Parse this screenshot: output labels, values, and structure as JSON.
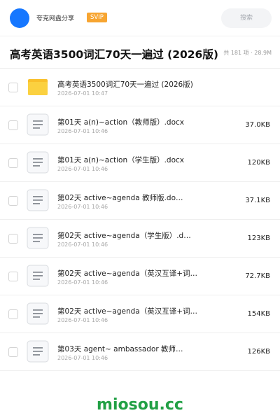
{
  "header": {
    "brand": "夸克网盘分享",
    "badge": "SVIP",
    "search_placeholder": "搜索"
  },
  "title": "高考英语3500词汇70天一遍过 (2026版)",
  "summary": "共 181 项 · 28.9M",
  "files": [
    {
      "icon": "folder-icon",
      "name": "高考英语3500词汇70天一遍过 (2026版)",
      "date": "2026-07-01 10:47",
      "size": ""
    },
    {
      "icon": "document-icon",
      "name": "第01天 a(n)~action（教师版）.docx",
      "date": "2026-07-01 10:46",
      "size": "37.0KB"
    },
    {
      "icon": "document-icon",
      "name": "第01天 a(n)~action（学生版）.docx",
      "date": "2026-07-01 10:46",
      "size": "120KB"
    },
    {
      "icon": "document-icon",
      "name": "第02天 active~agenda 教师版.do…",
      "date": "2026-07-01 10:46",
      "size": "37.1KB"
    },
    {
      "icon": "document-icon",
      "name": "第02天 active~agenda（学生版）.d…",
      "date": "2026-07-01 10:46",
      "size": "123KB"
    },
    {
      "icon": "document-icon",
      "name": "第02天 active~agenda（英汉互译+词…",
      "date": "2026-07-01 10:46",
      "size": "72.7KB"
    },
    {
      "icon": "document-icon",
      "name": "第02天 active~agenda（英汉互译+词…",
      "date": "2026-07-01 10:46",
      "size": "154KB"
    },
    {
      "icon": "document-icon",
      "name": "第03天 agent~ ambassador 教师…",
      "date": "2026-07-01 10:46",
      "size": "126KB"
    }
  ],
  "watermark": "miosou.cc"
}
